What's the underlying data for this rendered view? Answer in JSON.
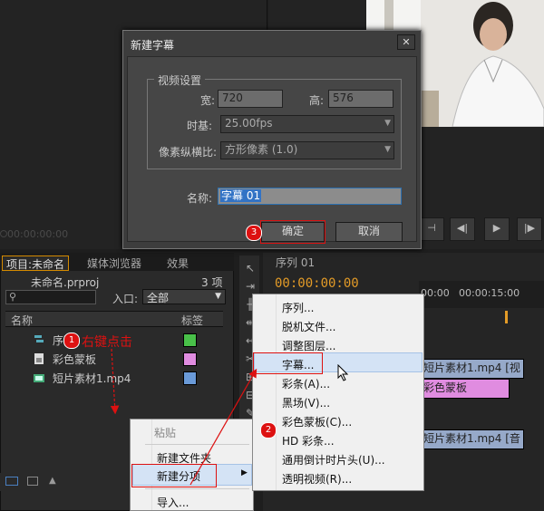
{
  "source_monitor": {
    "timecode": "00:00:00:00"
  },
  "program_monitor": {
    "transport_buttons": [
      "⊣",
      "◀|",
      "▶",
      "|▶"
    ]
  },
  "project_panel": {
    "tabs": [
      "项目:未命名",
      "媒体浏览器",
      "效果"
    ],
    "project_file": "未命名.prproj",
    "item_count": "3 项",
    "entry_label": "入口:",
    "entry_value": "全部",
    "columns": {
      "name": "名称",
      "label": "标签"
    },
    "items": [
      {
        "name": "序列",
        "label_color": "#49c049"
      },
      {
        "name": "彩色蒙板",
        "label_color": "#e08ce0"
      },
      {
        "name": "短片素材1.mp4",
        "label_color": "#6a9ad8"
      }
    ]
  },
  "timeline": {
    "tab": "序列 01",
    "timecode": "00:00:00:00",
    "ruler": [
      "00:00",
      "00:00:15:00"
    ],
    "clips": [
      "短片素材1.mp4 [视",
      "彩色蒙板",
      "短片素材1.mp4 [音"
    ]
  },
  "dialog": {
    "title": "新建字幕",
    "close": "✕",
    "group_title": "视频设置",
    "width_label": "宽:",
    "width_value": "720",
    "height_label": "高:",
    "height_value": "576",
    "timebase_label": "时基:",
    "timebase_value": "25.00fps",
    "par_label": "像素纵横比:",
    "par_value": "方形像素 (1.0)",
    "name_label": "名称:",
    "name_value": "字幕 01",
    "ok": "确定",
    "cancel": "取消"
  },
  "context_menu": {
    "items": [
      "粘贴",
      "新建文件夹",
      "新建分项",
      "导入..."
    ]
  },
  "submenu": {
    "items": [
      "序列...",
      "脱机文件...",
      "调整图层...",
      "字幕...",
      "彩条(A)...",
      "黑场(V)...",
      "彩色蒙板(C)...",
      "HD 彩条...",
      "通用倒计时片头(U)...",
      "透明视频(R)..."
    ]
  },
  "annotations": {
    "step1_text": "右键点击",
    "badges": [
      "1",
      "2",
      "3"
    ],
    "accent": "#dd1111"
  }
}
